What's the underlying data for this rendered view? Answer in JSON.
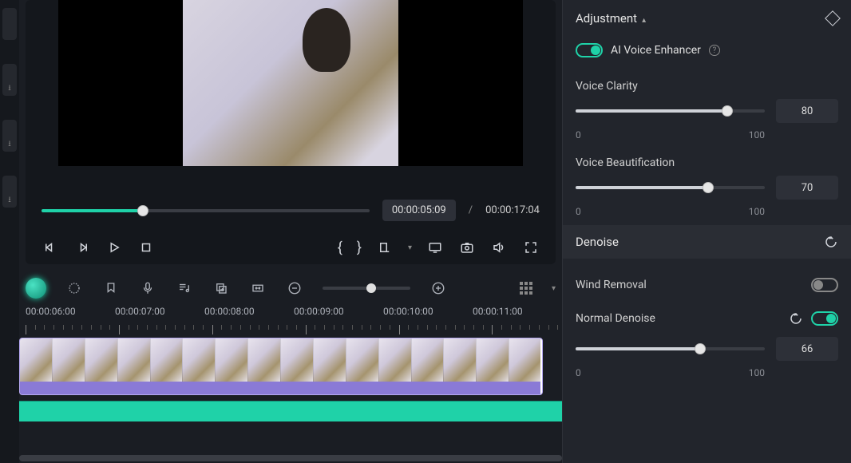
{
  "side_panel": {
    "adjustment_title": "Adjustment",
    "ai_voice_enhancer": {
      "label": "AI Voice Enhancer",
      "enabled": true
    },
    "voice_clarity": {
      "label": "Voice Clarity",
      "value": 80,
      "min": 0,
      "max": 100
    },
    "voice_beautification": {
      "label": "Voice Beautification",
      "value": 70,
      "min": 0,
      "max": 100
    },
    "denoise_title": "Denoise",
    "wind_removal": {
      "label": "Wind Removal",
      "enabled": false
    },
    "normal_denoise": {
      "label": "Normal Denoise",
      "enabled": true,
      "value": 66,
      "min": 0,
      "max": 100
    }
  },
  "playback": {
    "current_time": "00:00:05:09",
    "separator": "/",
    "total_time": "00:00:17:04",
    "progress_pct": 31
  },
  "zoom": {
    "pct": 55
  },
  "ruler_labels": [
    "00:00:06:00",
    "00:00:07:00",
    "00:00:08:00",
    "00:00:09:00",
    "00:00:10:00",
    "00:00:11:00"
  ]
}
